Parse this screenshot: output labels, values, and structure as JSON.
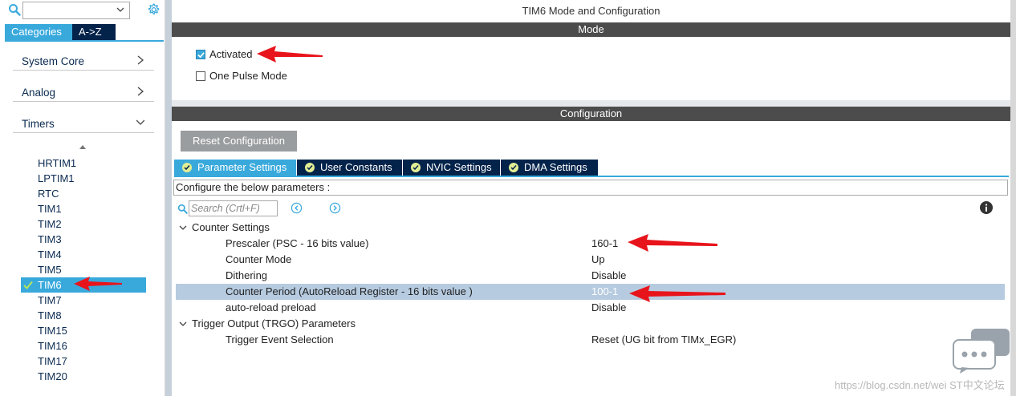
{
  "left_panel": {
    "search": {
      "value": ""
    },
    "view_tabs": {
      "categories": "Categories",
      "az": "A->Z"
    },
    "categories": [
      {
        "label": "System Core",
        "expanded": false
      },
      {
        "label": "Analog",
        "expanded": false
      },
      {
        "label": "Timers",
        "expanded": true
      }
    ],
    "timers": [
      "HRTIM1",
      "LPTIM1",
      "RTC",
      "TIM1",
      "TIM2",
      "TIM3",
      "TIM4",
      "TIM5",
      "TIM6",
      "TIM7",
      "TIM8",
      "TIM15",
      "TIM16",
      "TIM17",
      "TIM20"
    ],
    "selected_timer": "TIM6"
  },
  "right_panel": {
    "title": "TIM6 Mode and Configuration",
    "mode": {
      "header": "Mode",
      "activated": {
        "label": "Activated",
        "checked": true
      },
      "one_pulse": {
        "label": "One Pulse Mode",
        "checked": false
      }
    },
    "configuration": {
      "header": "Configuration",
      "reset_button": "Reset Configuration",
      "tabs": [
        "Parameter Settings",
        "User Constants",
        "NVIC Settings",
        "DMA Settings"
      ],
      "active_tab": "Parameter Settings",
      "hint": "Configure the below parameters :",
      "search_placeholder": "Search (Crtl+F)",
      "groups": [
        {
          "name": "Counter Settings",
          "params": [
            {
              "name": "Prescaler (PSC - 16 bits value)",
              "value": "160-1"
            },
            {
              "name": "Counter Mode",
              "value": "Up"
            },
            {
              "name": "Dithering",
              "value": "Disable"
            },
            {
              "name": "Counter Period (AutoReload Register - 16 bits value )",
              "value": "100-1",
              "selected": true
            },
            {
              "name": "auto-reload preload",
              "value": "Disable"
            }
          ]
        },
        {
          "name": "Trigger Output (TRGO) Parameters",
          "params": [
            {
              "name": "Trigger Event Selection",
              "value": "Reset (UG bit from TIMx_EGR)"
            }
          ]
        }
      ]
    }
  },
  "watermark": "https://blog.csdn.net/wei ST中文论坛",
  "colors": {
    "accent": "#39a9dc",
    "navy": "#03234b",
    "header_bar": "#4c4c4c",
    "selected_row": "#b6cbe0",
    "annotation_arrow": "#e8141c"
  }
}
